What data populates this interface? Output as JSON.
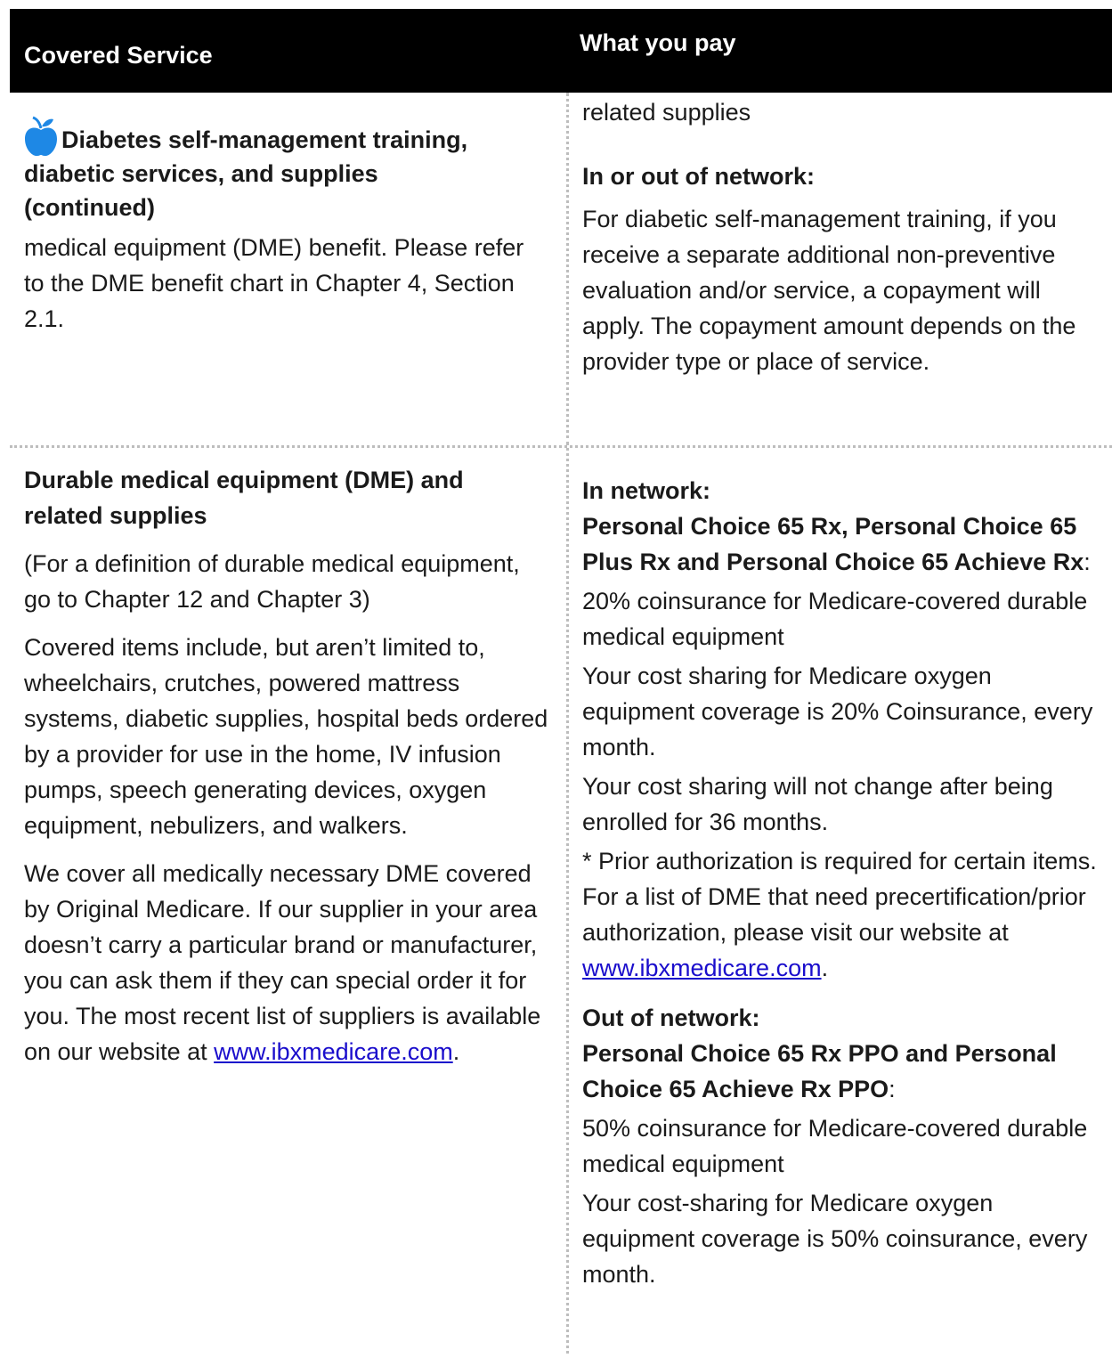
{
  "header": {
    "col1": "Covered Service",
    "col2": "What you pay"
  },
  "row1": {
    "left": {
      "title": "Diabetes self-management training, diabetic services, and supplies (continued)",
      "title_line1": "Diabetes self-management training,",
      "title_line2": "diabetic services, and supplies",
      "title_line3": "(continued)",
      "body": "medical equipment (DME) benefit. Please refer to the DME benefit chart in Chapter 4, Section 2.1."
    },
    "right": {
      "continued": "related supplies",
      "heading": "In or out of network:",
      "body": "For diabetic self-management training, if you receive a separate additional non-preventive evaluation and/or service, a copayment will apply. The copayment amount depends on the provider type or place of service."
    }
  },
  "row2": {
    "left": {
      "title": "Durable medical equipment (DME) and related supplies",
      "definition": "(For a definition of durable medical equipment, go to Chapter 12 and Chapter 3)",
      "items": "Covered items include, but aren’t limited to, wheelchairs, crutches, powered mattress systems, diabetic supplies, hospital beds ordered by a provider for use in the home, IV infusion pumps, speech generating devices, oxygen equipment, nebulizers, and walkers.",
      "coverage_text": "We cover all medically necessary DME covered by Original Medicare. If our supplier in your area doesn’t carry a particular brand or manufacturer, you can ask them if they can special order it for you. The most recent list of suppliers is available on our website at",
      "website": "www.ibxmedicare.com",
      "period": "."
    },
    "right": {
      "in_network_label": "In network:",
      "in_network_plans": "Personal Choice 65 Rx, Personal Choice 65 Plus Rx and Personal Choice 65 Achieve Rx",
      "colon": ":",
      "in_coins": "20% coinsurance for Medicare-covered durable medical equipment",
      "in_oxygen": "Your cost sharing for Medicare oxygen equipment coverage is 20% Coinsurance, every month.",
      "in_36": "Your cost sharing will not change after being enrolled for 36 months.",
      "prior_auth": "* Prior authorization is required for certain items. For a list of DME that need precertification/prior authorization, please visit our website at",
      "website": "www.ibxmedicare.com",
      "period": ".",
      "out_network_label": "Out of network:",
      "out_network_plans": "Personal Choice 65 Rx PPO and Personal Choice 65 Achieve Rx PPO",
      "out_coins": "50% coinsurance for Medicare-covered durable medical equipment",
      "out_oxygen": "Your cost-sharing for Medicare oxygen equipment coverage is 50% coinsurance, every month."
    }
  },
  "icons": {
    "apple": "apple-icon",
    "apple_color": "#1e88e5"
  }
}
